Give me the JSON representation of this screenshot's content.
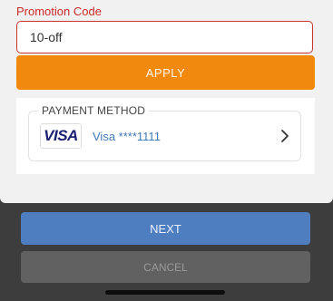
{
  "promotion": {
    "label": "Promotion Code",
    "input_value": "10-off",
    "apply_label": "APPLY"
  },
  "payment": {
    "section_label": "PAYMENT METHOD",
    "card_brand": "VISA",
    "card_text": "Visa ****1111"
  },
  "actions": {
    "next_label": "NEXT",
    "cancel_label": "CANCEL"
  },
  "colors": {
    "accent_orange": "#f2890f",
    "primary_blue": "#4e7ec0",
    "error_red": "#cc2a2a",
    "visa_blue": "#1a1f71"
  },
  "icons": {
    "chevron": "chevron-right-icon"
  }
}
